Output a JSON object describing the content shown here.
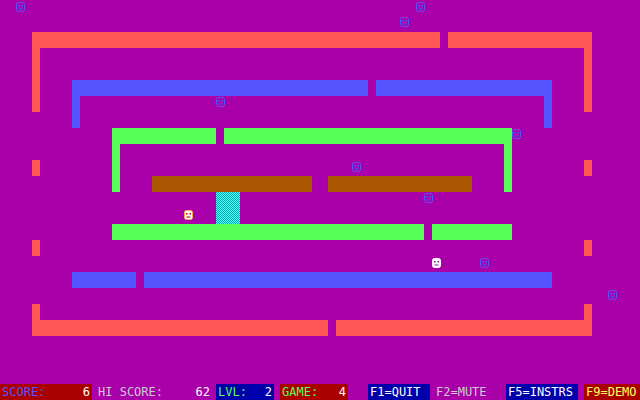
{
  "status_bar": {
    "score": {
      "label": "SCORE:",
      "value": "6"
    },
    "hi_score": {
      "label": "HI SCORE:",
      "value": "62"
    },
    "level": {
      "label": "LVL:",
      "value": "2"
    },
    "game": {
      "label": "GAME:",
      "value": "4"
    },
    "keys": [
      "F1=QUIT",
      "F2=MUTE",
      "F5=INSTRS",
      "F9=DEMO"
    ]
  },
  "sprites": [
    {
      "kind": "enemy"
    },
    {
      "kind": "enemy"
    },
    {
      "kind": "enemy"
    },
    {
      "kind": "enemy"
    },
    {
      "kind": "enemy"
    },
    {
      "kind": "enemy"
    },
    {
      "kind": "enemy"
    },
    {
      "kind": "enemy"
    },
    {
      "kind": "enemy"
    },
    {
      "kind": "player"
    },
    {
      "kind": "bonus"
    }
  ]
}
